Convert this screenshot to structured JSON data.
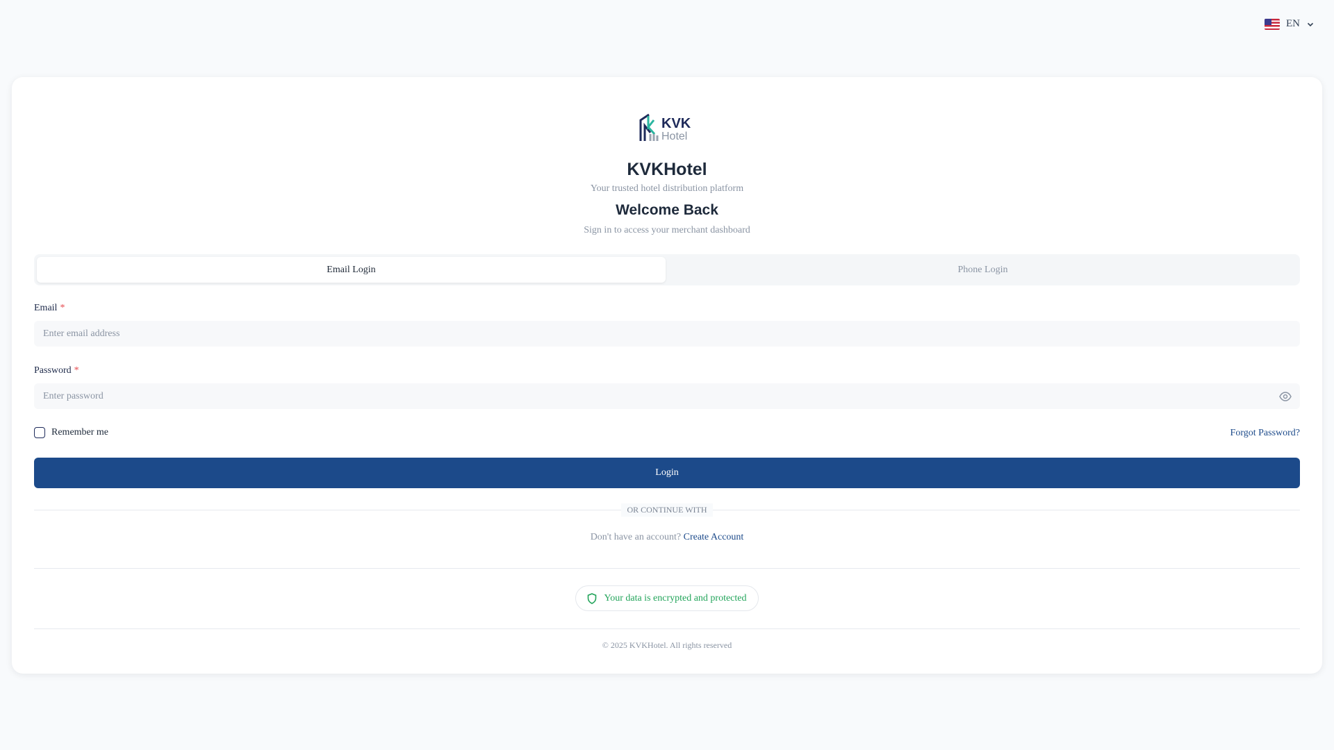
{
  "language": {
    "flag": "us-flag-icon",
    "code": "EN"
  },
  "brand": {
    "logo_text": "KVK Hotel",
    "name": "KVKHotel",
    "tagline": "Your trusted hotel distribution platform"
  },
  "heading": {
    "title": "Welcome Back",
    "subtitle": "Sign in to access your merchant dashboard"
  },
  "tabs": [
    {
      "label": "Email Login",
      "active": true
    },
    {
      "label": "Phone Login",
      "active": false
    }
  ],
  "form": {
    "email_label": "Email",
    "email_placeholder": "Enter email address",
    "email_value": "",
    "password_label": "Password",
    "password_placeholder": "Enter password",
    "password_value": "",
    "required_mark": "*",
    "remember_label": "Remember me",
    "remember_checked": false,
    "forgot_label": "Forgot Password?",
    "login_label": "Login"
  },
  "divider_text": "OR CONTINUE WITH",
  "signup": {
    "prompt": "Don't have an account?",
    "link": "Create Account"
  },
  "security_badge": "Your data is encrypted and protected",
  "footer": "© 2025 KVKHotel. All rights reserved",
  "colors": {
    "primary": "#1c4a8a",
    "success": "#22a45a",
    "required": "#e5484d"
  }
}
